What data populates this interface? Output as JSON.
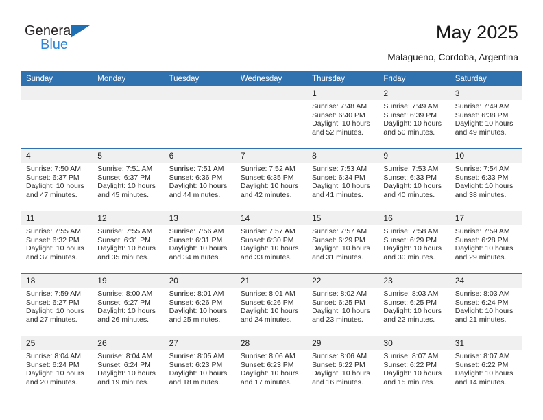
{
  "brand": {
    "name_part1": "General",
    "name_part2": "Blue",
    "triangle_icon": "triangle-icon",
    "accent_color": "#2e86d4"
  },
  "header": {
    "title": "May 2025",
    "location": "Malagueno, Cordoba, Argentina"
  },
  "colors": {
    "header_blue": "#3071b0",
    "daynum_band": "#f0f0f0",
    "text": "#1a1a1a"
  },
  "weekday_headers": [
    "Sunday",
    "Monday",
    "Tuesday",
    "Wednesday",
    "Thursday",
    "Friday",
    "Saturday"
  ],
  "labels": {
    "sunrise": "Sunrise:",
    "sunset": "Sunset:",
    "daylight": "Daylight:"
  },
  "weeks": [
    [
      {
        "day": "",
        "sunrise": "",
        "sunset": "",
        "daylight_line1": "",
        "daylight_line2": ""
      },
      {
        "day": "",
        "sunrise": "",
        "sunset": "",
        "daylight_line1": "",
        "daylight_line2": ""
      },
      {
        "day": "",
        "sunrise": "",
        "sunset": "",
        "daylight_line1": "",
        "daylight_line2": ""
      },
      {
        "day": "",
        "sunrise": "",
        "sunset": "",
        "daylight_line1": "",
        "daylight_line2": ""
      },
      {
        "day": "1",
        "sunrise": "Sunrise: 7:48 AM",
        "sunset": "Sunset: 6:40 PM",
        "daylight_line1": "Daylight: 10 hours",
        "daylight_line2": "and 52 minutes."
      },
      {
        "day": "2",
        "sunrise": "Sunrise: 7:49 AM",
        "sunset": "Sunset: 6:39 PM",
        "daylight_line1": "Daylight: 10 hours",
        "daylight_line2": "and 50 minutes."
      },
      {
        "day": "3",
        "sunrise": "Sunrise: 7:49 AM",
        "sunset": "Sunset: 6:38 PM",
        "daylight_line1": "Daylight: 10 hours",
        "daylight_line2": "and 49 minutes."
      }
    ],
    [
      {
        "day": "4",
        "sunrise": "Sunrise: 7:50 AM",
        "sunset": "Sunset: 6:37 PM",
        "daylight_line1": "Daylight: 10 hours",
        "daylight_line2": "and 47 minutes."
      },
      {
        "day": "5",
        "sunrise": "Sunrise: 7:51 AM",
        "sunset": "Sunset: 6:37 PM",
        "daylight_line1": "Daylight: 10 hours",
        "daylight_line2": "and 45 minutes."
      },
      {
        "day": "6",
        "sunrise": "Sunrise: 7:51 AM",
        "sunset": "Sunset: 6:36 PM",
        "daylight_line1": "Daylight: 10 hours",
        "daylight_line2": "and 44 minutes."
      },
      {
        "day": "7",
        "sunrise": "Sunrise: 7:52 AM",
        "sunset": "Sunset: 6:35 PM",
        "daylight_line1": "Daylight: 10 hours",
        "daylight_line2": "and 42 minutes."
      },
      {
        "day": "8",
        "sunrise": "Sunrise: 7:53 AM",
        "sunset": "Sunset: 6:34 PM",
        "daylight_line1": "Daylight: 10 hours",
        "daylight_line2": "and 41 minutes."
      },
      {
        "day": "9",
        "sunrise": "Sunrise: 7:53 AM",
        "sunset": "Sunset: 6:33 PM",
        "daylight_line1": "Daylight: 10 hours",
        "daylight_line2": "and 40 minutes."
      },
      {
        "day": "10",
        "sunrise": "Sunrise: 7:54 AM",
        "sunset": "Sunset: 6:33 PM",
        "daylight_line1": "Daylight: 10 hours",
        "daylight_line2": "and 38 minutes."
      }
    ],
    [
      {
        "day": "11",
        "sunrise": "Sunrise: 7:55 AM",
        "sunset": "Sunset: 6:32 PM",
        "daylight_line1": "Daylight: 10 hours",
        "daylight_line2": "and 37 minutes."
      },
      {
        "day": "12",
        "sunrise": "Sunrise: 7:55 AM",
        "sunset": "Sunset: 6:31 PM",
        "daylight_line1": "Daylight: 10 hours",
        "daylight_line2": "and 35 minutes."
      },
      {
        "day": "13",
        "sunrise": "Sunrise: 7:56 AM",
        "sunset": "Sunset: 6:31 PM",
        "daylight_line1": "Daylight: 10 hours",
        "daylight_line2": "and 34 minutes."
      },
      {
        "day": "14",
        "sunrise": "Sunrise: 7:57 AM",
        "sunset": "Sunset: 6:30 PM",
        "daylight_line1": "Daylight: 10 hours",
        "daylight_line2": "and 33 minutes."
      },
      {
        "day": "15",
        "sunrise": "Sunrise: 7:57 AM",
        "sunset": "Sunset: 6:29 PM",
        "daylight_line1": "Daylight: 10 hours",
        "daylight_line2": "and 31 minutes."
      },
      {
        "day": "16",
        "sunrise": "Sunrise: 7:58 AM",
        "sunset": "Sunset: 6:29 PM",
        "daylight_line1": "Daylight: 10 hours",
        "daylight_line2": "and 30 minutes."
      },
      {
        "day": "17",
        "sunrise": "Sunrise: 7:59 AM",
        "sunset": "Sunset: 6:28 PM",
        "daylight_line1": "Daylight: 10 hours",
        "daylight_line2": "and 29 minutes."
      }
    ],
    [
      {
        "day": "18",
        "sunrise": "Sunrise: 7:59 AM",
        "sunset": "Sunset: 6:27 PM",
        "daylight_line1": "Daylight: 10 hours",
        "daylight_line2": "and 27 minutes."
      },
      {
        "day": "19",
        "sunrise": "Sunrise: 8:00 AM",
        "sunset": "Sunset: 6:27 PM",
        "daylight_line1": "Daylight: 10 hours",
        "daylight_line2": "and 26 minutes."
      },
      {
        "day": "20",
        "sunrise": "Sunrise: 8:01 AM",
        "sunset": "Sunset: 6:26 PM",
        "daylight_line1": "Daylight: 10 hours",
        "daylight_line2": "and 25 minutes."
      },
      {
        "day": "21",
        "sunrise": "Sunrise: 8:01 AM",
        "sunset": "Sunset: 6:26 PM",
        "daylight_line1": "Daylight: 10 hours",
        "daylight_line2": "and 24 minutes."
      },
      {
        "day": "22",
        "sunrise": "Sunrise: 8:02 AM",
        "sunset": "Sunset: 6:25 PM",
        "daylight_line1": "Daylight: 10 hours",
        "daylight_line2": "and 23 minutes."
      },
      {
        "day": "23",
        "sunrise": "Sunrise: 8:03 AM",
        "sunset": "Sunset: 6:25 PM",
        "daylight_line1": "Daylight: 10 hours",
        "daylight_line2": "and 22 minutes."
      },
      {
        "day": "24",
        "sunrise": "Sunrise: 8:03 AM",
        "sunset": "Sunset: 6:24 PM",
        "daylight_line1": "Daylight: 10 hours",
        "daylight_line2": "and 21 minutes."
      }
    ],
    [
      {
        "day": "25",
        "sunrise": "Sunrise: 8:04 AM",
        "sunset": "Sunset: 6:24 PM",
        "daylight_line1": "Daylight: 10 hours",
        "daylight_line2": "and 20 minutes."
      },
      {
        "day": "26",
        "sunrise": "Sunrise: 8:04 AM",
        "sunset": "Sunset: 6:24 PM",
        "daylight_line1": "Daylight: 10 hours",
        "daylight_line2": "and 19 minutes."
      },
      {
        "day": "27",
        "sunrise": "Sunrise: 8:05 AM",
        "sunset": "Sunset: 6:23 PM",
        "daylight_line1": "Daylight: 10 hours",
        "daylight_line2": "and 18 minutes."
      },
      {
        "day": "28",
        "sunrise": "Sunrise: 8:06 AM",
        "sunset": "Sunset: 6:23 PM",
        "daylight_line1": "Daylight: 10 hours",
        "daylight_line2": "and 17 minutes."
      },
      {
        "day": "29",
        "sunrise": "Sunrise: 8:06 AM",
        "sunset": "Sunset: 6:22 PM",
        "daylight_line1": "Daylight: 10 hours",
        "daylight_line2": "and 16 minutes."
      },
      {
        "day": "30",
        "sunrise": "Sunrise: 8:07 AM",
        "sunset": "Sunset: 6:22 PM",
        "daylight_line1": "Daylight: 10 hours",
        "daylight_line2": "and 15 minutes."
      },
      {
        "day": "31",
        "sunrise": "Sunrise: 8:07 AM",
        "sunset": "Sunset: 6:22 PM",
        "daylight_line1": "Daylight: 10 hours",
        "daylight_line2": "and 14 minutes."
      }
    ]
  ]
}
